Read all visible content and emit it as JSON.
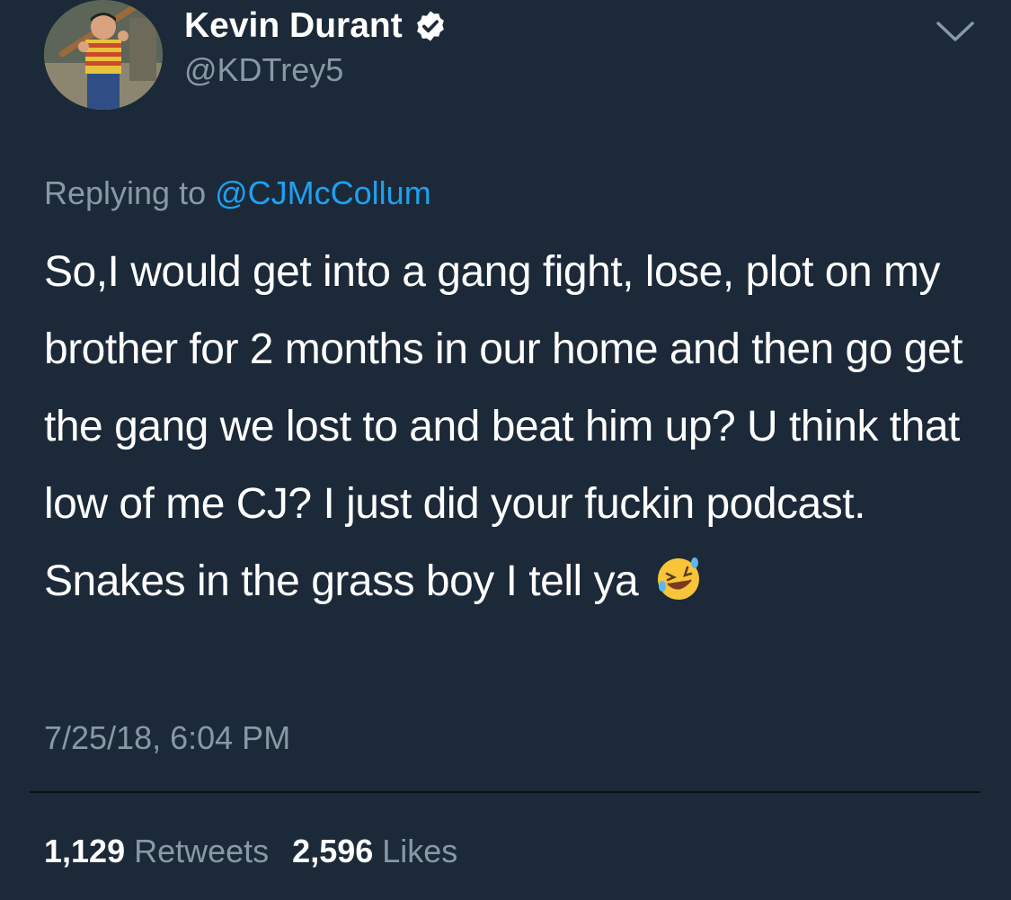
{
  "header": {
    "display_name": "Kevin Durant",
    "handle": "@KDTrey5",
    "verified": true
  },
  "reply": {
    "prefix": "Replying to",
    "mention": "@CJMcCollum"
  },
  "tweet": {
    "text": "So,I would get into a gang fight, lose, plot on my brother for 2 months in our home and then go get the gang we lost to and beat him up? U think that low of me CJ? I just did your fuckin podcast. Snakes in the grass boy I tell ya",
    "emoji": "rolling-on-floor-laughing-emoji",
    "timestamp": "7/25/18, 6:04 PM"
  },
  "stats": {
    "retweets_count": "1,129",
    "retweets_label": "Retweets",
    "likes_count": "2,596",
    "likes_label": "Likes"
  },
  "colors": {
    "background": "#1c2938",
    "link": "#1da1f2",
    "secondary_text": "#8899a6",
    "primary_text": "#ffffff"
  }
}
